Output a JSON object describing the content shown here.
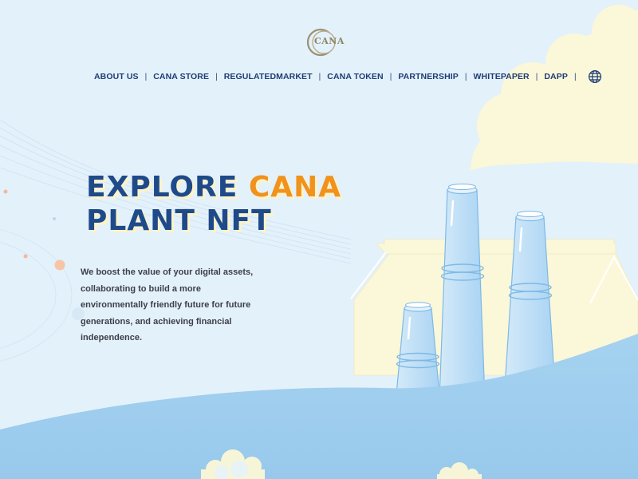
{
  "brand": {
    "logo_text": "CANA"
  },
  "nav": {
    "items": [
      {
        "label": "ABOUT US"
      },
      {
        "label": "CANA STORE"
      },
      {
        "label": "REGULATEDMARKET"
      },
      {
        "label": "CANA TOKEN"
      },
      {
        "label": "PARTNERSHIP"
      },
      {
        "label": "WHITEPAPER"
      },
      {
        "label": "DAPP"
      }
    ],
    "language_icon": "globe-icon"
  },
  "hero": {
    "title_word1": "EXPLORE",
    "title_accent": "CANA",
    "title_line2": "PLANT NFT",
    "description": "We boost the value of your digital assets, collaborating to build a more environmentally friendly future for future generations, and achieving financial independence."
  },
  "colors": {
    "background": "#e3f1fb",
    "navy": "#1f4a8a",
    "accent": "#f0921c",
    "smoke": "#fbf7d9",
    "ground": "#9fcfee"
  }
}
